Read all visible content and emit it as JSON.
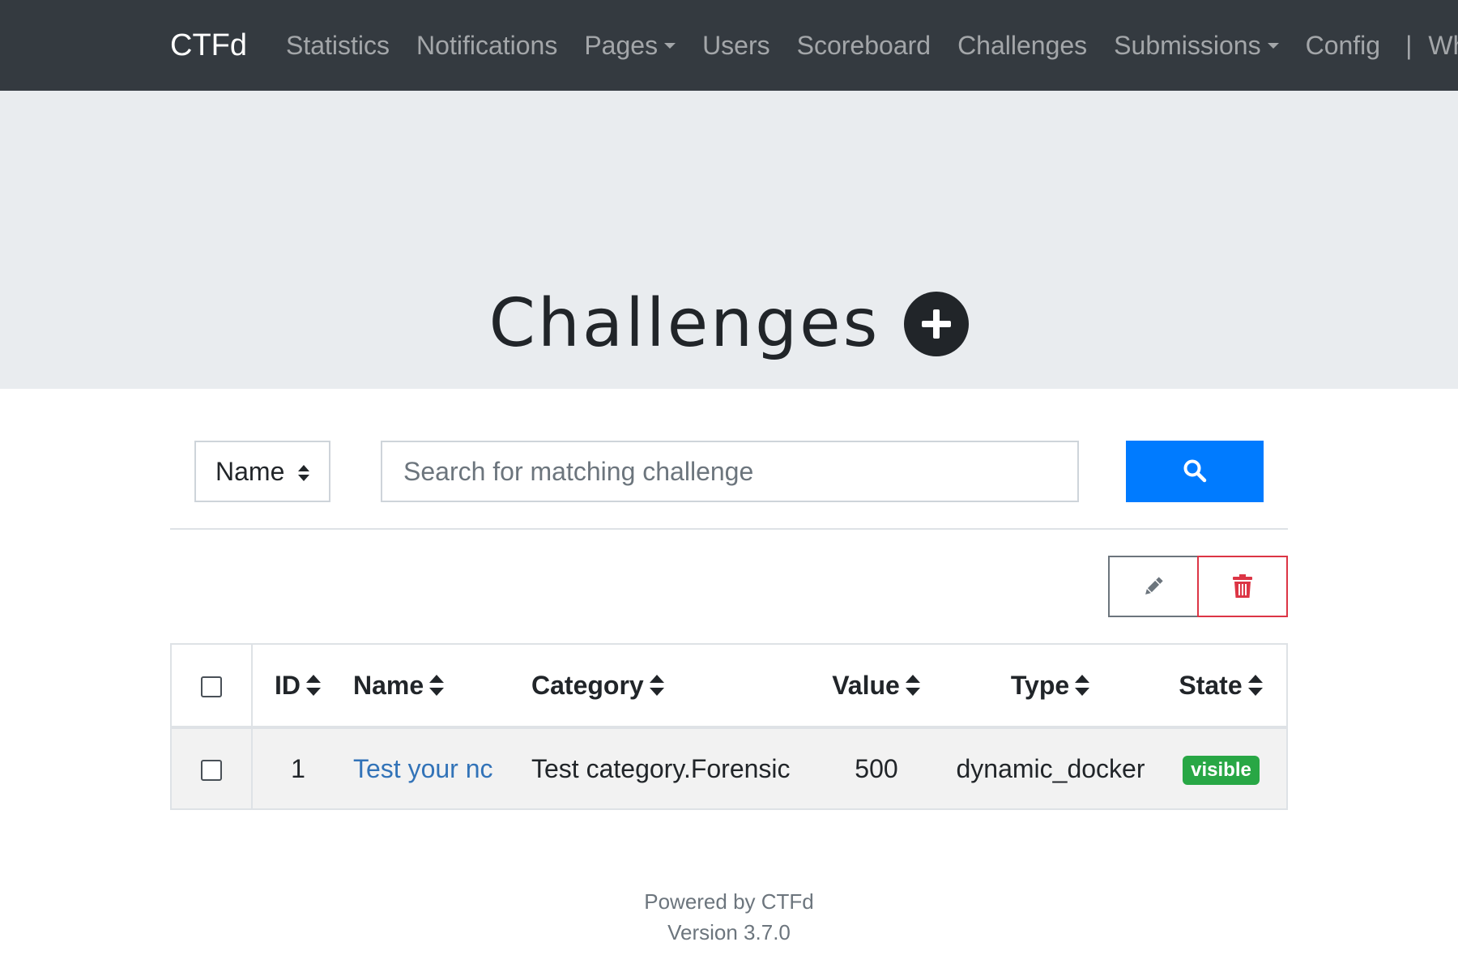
{
  "navbar": {
    "brand": "CTFd",
    "items": [
      {
        "label": "Statistics",
        "dropdown": false
      },
      {
        "label": "Notifications",
        "dropdown": false
      },
      {
        "label": "Pages",
        "dropdown": true
      },
      {
        "label": "Users",
        "dropdown": false
      },
      {
        "label": "Scoreboard",
        "dropdown": false
      },
      {
        "label": "Challenges",
        "dropdown": false
      },
      {
        "label": "Submissions",
        "dropdown": true
      },
      {
        "label": "Config",
        "dropdown": false
      }
    ],
    "separator": "|",
    "overflow_label": "Wh"
  },
  "header": {
    "title": "Challenges",
    "add_icon": "plus-circle-icon"
  },
  "search": {
    "field_selected": "Name",
    "placeholder": "Search for matching challenge",
    "value": "",
    "button_icon": "search-icon"
  },
  "actions": {
    "edit_icon": "pencil-icon",
    "delete_icon": "trash-icon"
  },
  "table": {
    "columns": [
      "ID",
      "Name",
      "Category",
      "Value",
      "Type",
      "State"
    ],
    "rows": [
      {
        "id": "1",
        "name": "Test your nc",
        "category": "Test category.Forensic",
        "value": "500",
        "type": "dynamic_docker",
        "state": "visible"
      }
    ]
  },
  "footer": {
    "powered_by": "Powered by CTFd",
    "version": "Version 3.7.0"
  },
  "colors": {
    "navbar_bg": "#343a40",
    "jumbotron_bg": "#e9ecef",
    "primary": "#007bff",
    "danger": "#dc3545",
    "success": "#28a745",
    "link": "#3273b8"
  }
}
